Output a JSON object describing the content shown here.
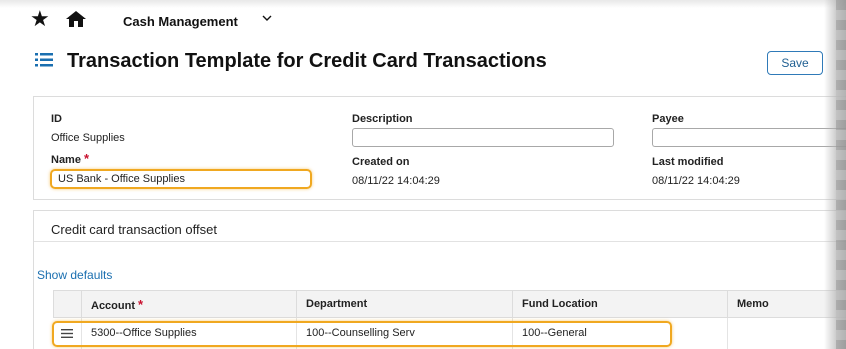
{
  "nav": {
    "app_name": "Cash Management"
  },
  "header": {
    "title": "Transaction Template for Credit Card Transactions",
    "save_label": "Save"
  },
  "details": {
    "id_label": "ID",
    "id_value": "Office Supplies",
    "name_label": "Name",
    "name_value": "US Bank - Office Supplies",
    "required_mark": "*",
    "description_label": "Description",
    "description_value": "",
    "payee_label": "Payee",
    "payee_value": "",
    "created_label": "Created on",
    "created_value": "08/11/22 14:04:29",
    "modified_label": "Last modified",
    "modified_value": "08/11/22 14:04:29"
  },
  "offset": {
    "section_title": "Credit card transaction offset",
    "show_defaults": "Show defaults",
    "columns": {
      "account": "Account",
      "department": "Department",
      "fund_location": "Fund Location",
      "memo": "Memo"
    },
    "rows": [
      {
        "account": "5300--Office Supplies",
        "department": "100--Counselling Serv",
        "fund_location": "100--General",
        "memo": ""
      }
    ]
  },
  "colors": {
    "accent": "#1a6fb0",
    "highlight": "#f0a820",
    "required": "#c8102e"
  },
  "icons": {
    "favorite": "star-icon",
    "home": "home-icon",
    "app_menu": "chevron-down-icon",
    "page_menu": "list-menu-icon",
    "row_drag": "drag-handle-icon"
  }
}
